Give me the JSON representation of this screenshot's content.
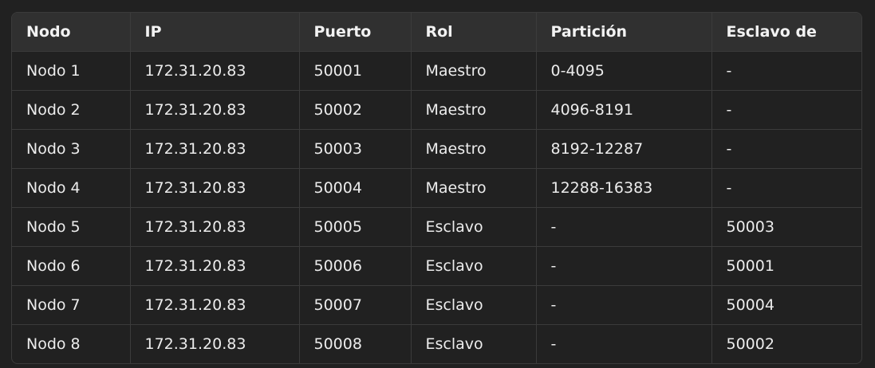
{
  "table": {
    "headers": [
      "Nodo",
      "IP",
      "Puerto",
      "Rol",
      "Partición",
      "Esclavo de"
    ],
    "rows": [
      [
        "Nodo 1",
        "172.31.20.83",
        "50001",
        "Maestro",
        "0-4095",
        "-"
      ],
      [
        "Nodo 2",
        "172.31.20.83",
        "50002",
        "Maestro",
        "4096-8191",
        "-"
      ],
      [
        "Nodo 3",
        "172.31.20.83",
        "50003",
        "Maestro",
        "8192-12287",
        "-"
      ],
      [
        "Nodo 4",
        "172.31.20.83",
        "50004",
        "Maestro",
        "12288-16383",
        "-"
      ],
      [
        "Nodo 5",
        "172.31.20.83",
        "50005",
        "Esclavo",
        "-",
        "50003"
      ],
      [
        "Nodo 6",
        "172.31.20.83",
        "50006",
        "Esclavo",
        "-",
        "50001"
      ],
      [
        "Nodo 7",
        "172.31.20.83",
        "50007",
        "Esclavo",
        "-",
        "50004"
      ],
      [
        "Nodo 8",
        "172.31.20.83",
        "50008",
        "Esclavo",
        "-",
        "50002"
      ]
    ]
  }
}
